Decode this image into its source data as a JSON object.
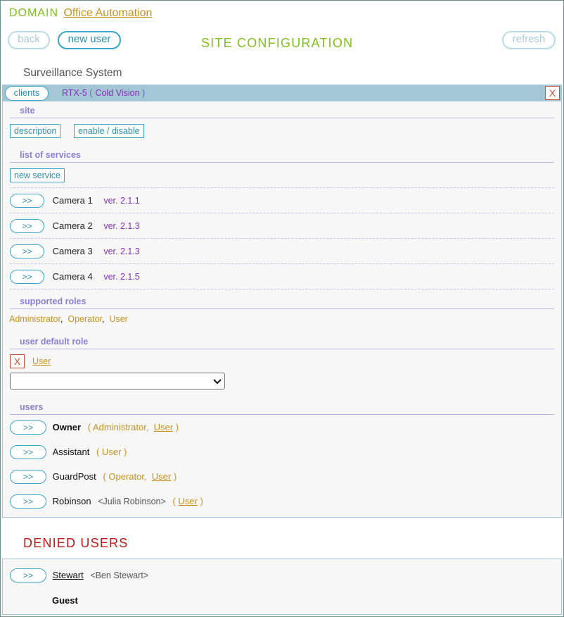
{
  "header": {
    "domain_label": "DOMAIN",
    "domain_name": "Office Automation",
    "back_label": "back",
    "new_user_label": "new user",
    "page_title": "SITE CONFIGURATION",
    "refresh_label": "refresh"
  },
  "system_name": "Surveillance System",
  "client_bar": {
    "clients_label": "clients",
    "client_id": "RTX-5",
    "open_paren": "(",
    "client_name": "Cold Vision",
    "close_paren": ")",
    "close_label": "X"
  },
  "site": {
    "heading": "site",
    "description_label": "description",
    "enable_label": "enable / disable"
  },
  "services": {
    "heading": "list of services",
    "new_service_label": "new service",
    "expand_label": ">>",
    "items": [
      {
        "name": "Camera 1",
        "version": "ver. 2.1.1"
      },
      {
        "name": "Camera 2",
        "version": "ver. 2.1.3"
      },
      {
        "name": "Camera 3",
        "version": "ver. 2.1.3"
      },
      {
        "name": "Camera 4",
        "version": "ver. 2.1.5"
      }
    ]
  },
  "roles": {
    "heading": "supported roles",
    "items": [
      "Administrator",
      "Operator",
      "User"
    ]
  },
  "default_role": {
    "heading": "user default role",
    "remove_label": "X",
    "value": "User",
    "select_value": ""
  },
  "users": {
    "heading": "users",
    "expand_label": ">>",
    "items": [
      {
        "name": "Owner",
        "fullname": "",
        "roles": [
          "Administrator",
          "User"
        ]
      },
      {
        "name": "Assistant",
        "fullname": "",
        "roles": [
          "User"
        ]
      },
      {
        "name": "GuardPost",
        "fullname": "",
        "roles": [
          "Operator",
          "User"
        ]
      },
      {
        "name": "Robinson",
        "fullname": "<Julia Robinson>",
        "roles": [
          "User"
        ]
      }
    ]
  },
  "denied": {
    "heading": "DENIED USERS",
    "expand_label": ">>",
    "user_name": "Stewart",
    "user_fullname": "<Ben Stewart>",
    "role": "Guest"
  },
  "colors": {
    "green": "#7fbf1e",
    "teal": "#3aa6c8",
    "bar": "#a2c6d4",
    "gold": "#c8921e",
    "purple": "#8a2ec2",
    "denied": "#c41616",
    "section": "#8b7fd6"
  }
}
